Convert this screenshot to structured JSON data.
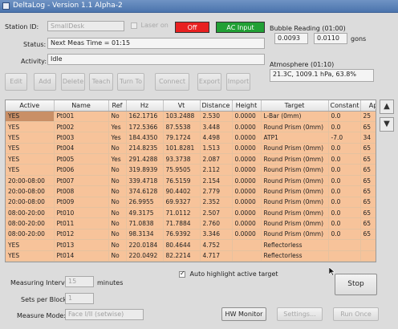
{
  "window": {
    "title": "DeltaLog - Version 1.1 Alpha-2"
  },
  "station": {
    "label": "Station ID:",
    "value": "SmallDesk",
    "laser_label": "Laser on"
  },
  "indicators": {
    "off_label": "Off",
    "off_color": "#e82020",
    "ac_label": "AC Input",
    "ac_color": "#21a035"
  },
  "status": {
    "label": "Status:",
    "value": "Next Meas Time = 01:15"
  },
  "activity": {
    "label": "Activity:",
    "value": "Idle"
  },
  "bubble": {
    "label": "Bubble Reading (01:00)",
    "value1": "0.0093",
    "value2": "0.0110",
    "unit": "gons"
  },
  "atmosphere": {
    "label": "Atmosphere (01:10)",
    "value": "21.3C, 1009.1 hPa, 63.8%"
  },
  "toolbar": [
    "Edit",
    "Add",
    "Delete",
    "Teach",
    "Turn To",
    "Connect",
    "Export",
    "Import"
  ],
  "table": {
    "columns": [
      "Active",
      "Name",
      "Ref",
      "Hz",
      "Vt",
      "Distance",
      "Height",
      "Target",
      "Constant",
      "Ap"
    ],
    "rows": [
      [
        "YES",
        "Pt001",
        "No",
        "162.1716",
        "103.2488",
        "2.530",
        "0.0000",
        "L-Bar (0mm)",
        "0.0",
        "25"
      ],
      [
        "YES",
        "Pt002",
        "Yes",
        "172.5366",
        "87.5538",
        "3.448",
        "0.0000",
        "Round Prism (0mm)",
        "0.0",
        "65"
      ],
      [
        "YES",
        "Pt003",
        "Yes",
        "184.4350",
        "79.1724",
        "4.498",
        "0.0000",
        "ATP1",
        "-7.0",
        "34"
      ],
      [
        "YES",
        "Pt004",
        "No",
        "214.8235",
        "101.8281",
        "1.513",
        "0.0000",
        "Round Prism (0mm)",
        "0.0",
        "65"
      ],
      [
        "YES",
        "Pt005",
        "Yes",
        "291.4288",
        "93.3738",
        "2.087",
        "0.0000",
        "Round Prism (0mm)",
        "0.0",
        "65"
      ],
      [
        "YES",
        "Pt006",
        "No",
        "319.8939",
        "75.9505",
        "2.112",
        "0.0000",
        "Round Prism (0mm)",
        "0.0",
        "65"
      ],
      [
        "20:00-08:00",
        "Pt007",
        "No",
        "339.4718",
        "76.5159",
        "2.154",
        "0.0000",
        "Round Prism (0mm)",
        "0.0",
        "65"
      ],
      [
        "20:00-08:00",
        "Pt008",
        "No",
        "374.6128",
        "90.4402",
        "2.779",
        "0.0000",
        "Round Prism (0mm)",
        "0.0",
        "65"
      ],
      [
        "20:00-08:00",
        "Pt009",
        "No",
        "26.9955",
        "69.9327",
        "2.352",
        "0.0000",
        "Round Prism (0mm)",
        "0.0",
        "65"
      ],
      [
        "08:00-20:00",
        "Pt010",
        "No",
        "49.3175",
        "71.0112",
        "2.507",
        "0.0000",
        "Round Prism (0mm)",
        "0.0",
        "65"
      ],
      [
        "08:00-20:00",
        "Pt011",
        "No",
        "71.0838",
        "71.7884",
        "2.760",
        "0.0000",
        "Round Prism (0mm)",
        "0.0",
        "65"
      ],
      [
        "08:00-20:00",
        "Pt012",
        "No",
        "98.3134",
        "76.9392",
        "3.346",
        "0.0000",
        "Round Prism (0mm)",
        "0.0",
        "65"
      ],
      [
        "YES",
        "Pt013",
        "No",
        "220.0184",
        "80.4644",
        "4.752",
        "",
        "Reflectorless",
        "",
        ""
      ],
      [
        "YES",
        "Pt014",
        "No",
        "220.0492",
        "82.2214",
        "4.717",
        "",
        "Reflectorless",
        "",
        ""
      ]
    ]
  },
  "scroll": {
    "up_icon": "▲",
    "down_icon": "▼"
  },
  "auto_highlight": {
    "label": "Auto highlight active target",
    "checked": true
  },
  "stop_label": "Stop",
  "measuring_interval": {
    "label": "Measuring Interval:",
    "value": "15",
    "unit": "minutes"
  },
  "sets_per_block": {
    "label": "Sets per Block:",
    "value": "1"
  },
  "measure_mode": {
    "label": "Measure Mode:",
    "value": "Face I/II (setwise)"
  },
  "bottom_buttons": {
    "hw_monitor": "HW Monitor",
    "settings": "Settings...",
    "run_once": "Run Once"
  }
}
